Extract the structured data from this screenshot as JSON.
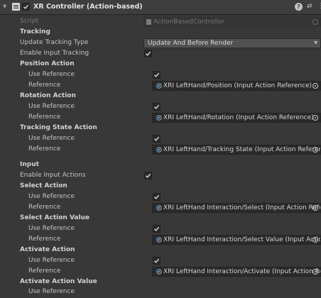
{
  "header": {
    "title": "XR Controller (Action-based)",
    "enabled": true,
    "help_icon": "help-icon",
    "preset_icon": "preset-icon",
    "menu_icon": "kebab-menu-icon"
  },
  "script_row": {
    "label": "Script",
    "value": "ActionBasedController"
  },
  "tracking": {
    "section_label": "Tracking",
    "update_type_label": "Update Tracking Type",
    "update_type_value": "Update And Before Render",
    "enable_input_tracking_label": "Enable Input Tracking",
    "enable_input_tracking": true,
    "position_action": {
      "label": "Position Action",
      "use_reference_label": "Use Reference",
      "use_reference": true,
      "reference_label": "Reference",
      "reference_value": "XRI LeftHand/Position (Input Action Reference)"
    },
    "rotation_action": {
      "label": "Rotation Action",
      "use_reference_label": "Use Reference",
      "use_reference": true,
      "reference_label": "Reference",
      "reference_value": "XRI LeftHand/Rotation (Input Action Reference)"
    },
    "tracking_state_action": {
      "label": "Tracking State Action",
      "use_reference_label": "Use Reference",
      "use_reference": true,
      "reference_label": "Reference",
      "reference_value": "XRI LeftHand/Tracking State (Input Action Referenc"
    }
  },
  "input": {
    "section_label": "Input",
    "enable_input_actions_label": "Enable Input Actions",
    "enable_input_actions": true,
    "select_action": {
      "label": "Select Action",
      "use_reference_label": "Use Reference",
      "use_reference": true,
      "reference_label": "Reference",
      "reference_value": "XRI LeftHand Interaction/Select (Input Action Refer"
    },
    "select_action_value": {
      "label": "Select Action Value",
      "use_reference_label": "Use Reference",
      "use_reference": true,
      "reference_label": "Reference",
      "reference_value": "XRI LeftHand Interaction/Select Value (Input Action"
    },
    "activate_action": {
      "label": "Activate Action",
      "use_reference_label": "Use Reference",
      "use_reference": true,
      "reference_label": "Reference",
      "reference_value": "XRI LeftHand Interaction/Activate (Input Action Ref"
    },
    "activate_action_value": {
      "label": "Activate Action Value",
      "use_reference_label": "Use Reference"
    }
  },
  "colors": {
    "background": "#383838",
    "header": "#3e3e3e",
    "field": "#2a2a2a",
    "text": "#c4c4c4"
  }
}
